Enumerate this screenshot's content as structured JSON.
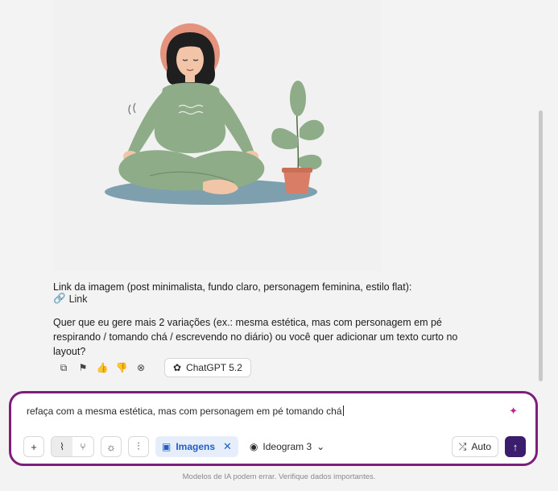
{
  "message": {
    "link_intro": "Link da imagem (post minimalista, fundo claro, personagem feminina, estilo flat):",
    "link_label": "Link",
    "question": "Quer que eu gere mais 2 variações (ex.: mesma estética, mas com personagem em pé respirando / tomando chá / escrevendo no diário) ou você quer adicionar um texto curto no layout?"
  },
  "actions": {
    "model_label": "ChatGPT 5.2"
  },
  "composer": {
    "input_value": "refaça com a mesma estética, mas com personagem em pé tomando chá",
    "images_chip": "Imagens",
    "model_select": "Ideogram 3",
    "auto_label": "Auto"
  },
  "footer": {
    "disclaimer": "Modelos de IA podem errar. Verifique dados importantes."
  },
  "colors": {
    "composer_border": "#7c1f7a",
    "send_button": "#3b1d6e",
    "images_chip_bg": "#e6eefb",
    "images_chip_text": "#1f5fc6"
  }
}
